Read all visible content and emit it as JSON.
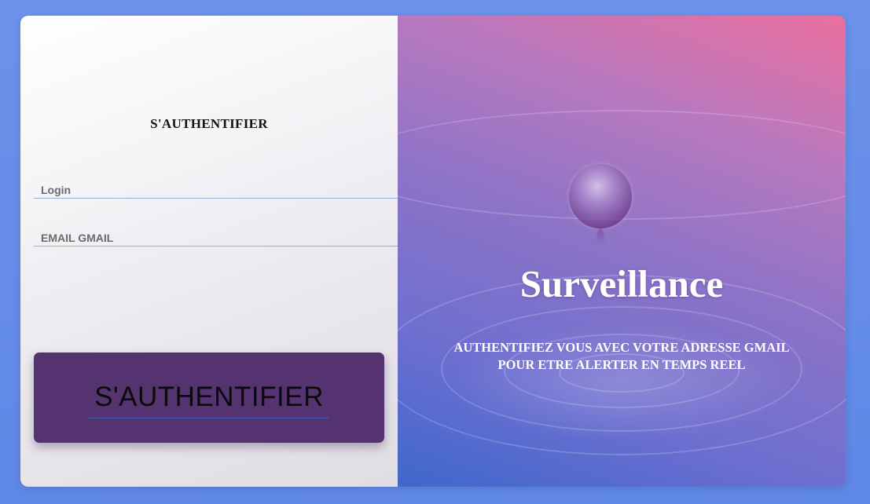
{
  "login_form": {
    "title": "S'AUTHENTIFIER",
    "login_placeholder": "Login",
    "email_placeholder": "EMAIL GMAIL",
    "submit_label": "S'AUTHENTIFIER"
  },
  "hero": {
    "title": "Surveillance",
    "subtitle_line1": "AUTHENTIFIEZ VOUS AVEC VOTRE ADRESSE GMAIL",
    "subtitle_line2": "POUR ETRE ALERTER EN TEMPS REEL"
  },
  "colors": {
    "background": "#6b93ea",
    "button": "#553370",
    "field_underline": "#8fb0d8",
    "hero_gradient_top": "#ea6f9f",
    "hero_gradient_bottom": "#3f67cc"
  }
}
